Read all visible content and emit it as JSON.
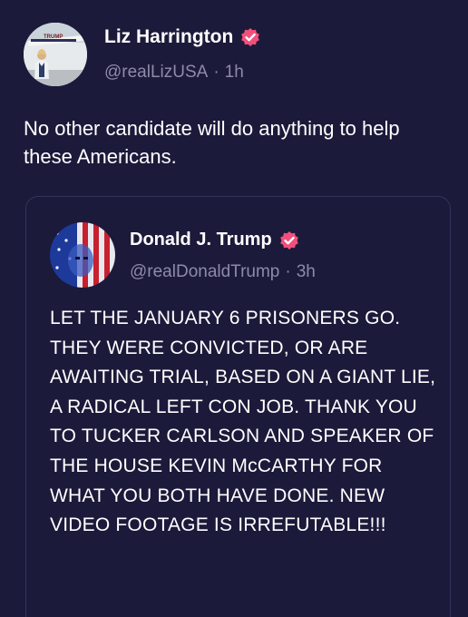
{
  "post": {
    "author_name": "Liz Harrington",
    "handle": "@realLizUSA",
    "separator": "·",
    "time": "1h",
    "avatar_banner_text": "TRUMP",
    "text": "No other candidate will do anything to help these Americans."
  },
  "quoted_post": {
    "author_name": "Donald J. Trump",
    "handle": "@realDonaldTrump",
    "separator": "·",
    "time": "3h",
    "text": "LET THE JANUARY 6 PRISONERS GO. THEY WERE CONVICTED, OR ARE AWAITING TRIAL, BASED ON A GIANT LIE, A RADICAL LEFT CON JOB. THANK YOU TO TUCKER CARLSON AND SPEAKER OF THE HOUSE KEVIN McCARTHY FOR WHAT YOU BOTH HAVE DONE. NEW VIDEO FOOTAGE IS IRREFUTABLE!!!"
  },
  "colors": {
    "background": "#1c1a3a",
    "verified_badge": "#f2507b",
    "muted_text": "#8d8ba8",
    "card_border": "#34325a"
  },
  "icons": {
    "verified": "verified-badge-icon"
  }
}
